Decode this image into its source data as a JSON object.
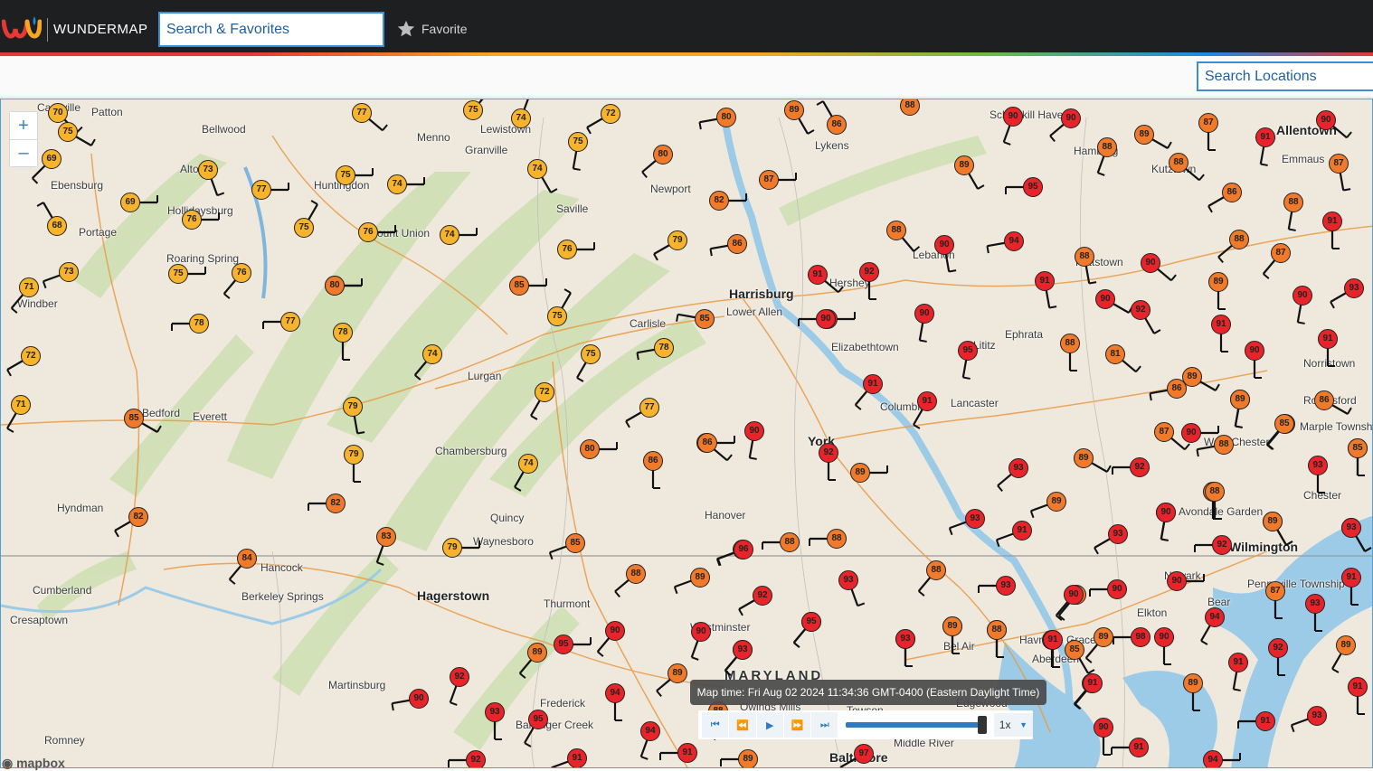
{
  "header": {
    "brand": "WUNDERMAP",
    "search_placeholder": "Search & Favorites",
    "favorite_label": "Favorite"
  },
  "subheader": {
    "location_search_placeholder": "Search Locations"
  },
  "map": {
    "zoom_in_label": "+",
    "zoom_out_label": "–",
    "attribution": "mapbox",
    "state_label": "MARYLAND",
    "places": [
      {
        "name": "Cassville"
      },
      {
        "name": "Patton"
      },
      {
        "name": "Bellwood"
      },
      {
        "name": "Menno"
      },
      {
        "name": "Lewistown"
      },
      {
        "name": "Granville"
      },
      {
        "name": "Altoona"
      },
      {
        "name": "Huntingdon"
      },
      {
        "name": "Ebensburg"
      },
      {
        "name": "Hollidaysburg"
      },
      {
        "name": "Portage"
      },
      {
        "name": "Roaring Spring"
      },
      {
        "name": "Windber"
      },
      {
        "name": "Mount Union"
      },
      {
        "name": "Saville"
      },
      {
        "name": "Newport"
      },
      {
        "name": "Harrisburg"
      },
      {
        "name": "Lower Allen"
      },
      {
        "name": "Carlisle"
      },
      {
        "name": "Hershey"
      },
      {
        "name": "Lebanon"
      },
      {
        "name": "Hamburg"
      },
      {
        "name": "Kutztown"
      },
      {
        "name": "Allentown"
      },
      {
        "name": "Emmaus"
      },
      {
        "name": "Lykens"
      },
      {
        "name": "Schuylkill Haven"
      },
      {
        "name": "Elizabethtown"
      },
      {
        "name": "Lancaster"
      },
      {
        "name": "Columbia"
      },
      {
        "name": "Ephrata"
      },
      {
        "name": "Lititz"
      },
      {
        "name": "Pottstown"
      },
      {
        "name": "Norristown"
      },
      {
        "name": "Royersford"
      },
      {
        "name": "West Chester"
      },
      {
        "name": "Marple Township"
      },
      {
        "name": "Bedford"
      },
      {
        "name": "Everett"
      },
      {
        "name": "Lurgan"
      },
      {
        "name": "Chambersburg"
      },
      {
        "name": "York"
      },
      {
        "name": "Hanover"
      },
      {
        "name": "Quincy"
      },
      {
        "name": "Waynesboro"
      },
      {
        "name": "Hyndman"
      },
      {
        "name": "Hancock"
      },
      {
        "name": "Cumberland"
      },
      {
        "name": "Berkeley Springs"
      },
      {
        "name": "Hagerstown"
      },
      {
        "name": "Thurmont"
      },
      {
        "name": "Westminster"
      },
      {
        "name": "Bel Air"
      },
      {
        "name": "Havre de Grace"
      },
      {
        "name": "Aberdeen"
      },
      {
        "name": "Elkton"
      },
      {
        "name": "Newark"
      },
      {
        "name": "Wilmington"
      },
      {
        "name": "Chester"
      },
      {
        "name": "Avondale Garden"
      },
      {
        "name": "Pennsville Township"
      },
      {
        "name": "Bear"
      },
      {
        "name": "Cresaptown"
      },
      {
        "name": "Martinsburg"
      },
      {
        "name": "Frederick"
      },
      {
        "name": "Ballenger Creek"
      },
      {
        "name": "Owings Mills"
      },
      {
        "name": "Towson"
      },
      {
        "name": "Edgewood"
      },
      {
        "name": "Middle River"
      },
      {
        "name": "Baltimore"
      },
      {
        "name": "Romney"
      }
    ],
    "stations": [
      {
        "t": 70
      },
      {
        "t": 69
      },
      {
        "t": 75
      },
      {
        "t": 73
      },
      {
        "t": 69
      },
      {
        "t": 68
      },
      {
        "t": 73
      },
      {
        "t": 71
      },
      {
        "t": 72
      },
      {
        "t": 71
      },
      {
        "t": 77
      },
      {
        "t": 75
      },
      {
        "t": 74
      },
      {
        "t": 72
      },
      {
        "t": 80
      },
      {
        "t": 89
      },
      {
        "t": 86
      },
      {
        "t": 88
      },
      {
        "t": 90
      },
      {
        "t": 90
      },
      {
        "t": 87
      },
      {
        "t": 89
      },
      {
        "t": 91
      },
      {
        "t": 90
      },
      {
        "t": 75
      },
      {
        "t": 74
      },
      {
        "t": 80
      },
      {
        "t": 87
      },
      {
        "t": 88
      },
      {
        "t": 88
      },
      {
        "t": 89
      },
      {
        "t": 95
      },
      {
        "t": 86
      },
      {
        "t": 87
      },
      {
        "t": 75
      },
      {
        "t": 74
      },
      {
        "t": 75
      },
      {
        "t": 76
      },
      {
        "t": 82
      },
      {
        "t": 88
      },
      {
        "t": 94
      },
      {
        "t": 91
      },
      {
        "t": 88
      },
      {
        "t": 90
      },
      {
        "t": 88
      },
      {
        "t": 87
      },
      {
        "t": 77
      },
      {
        "t": 76
      },
      {
        "t": 74
      },
      {
        "t": 79
      },
      {
        "t": 86
      },
      {
        "t": 91
      },
      {
        "t": 92
      },
      {
        "t": 90
      },
      {
        "t": 76
      },
      {
        "t": 75
      },
      {
        "t": 78
      },
      {
        "t": 78
      },
      {
        "t": 85
      },
      {
        "t": 88
      },
      {
        "t": 90
      },
      {
        "t": 90
      },
      {
        "t": 95
      },
      {
        "t": 91
      },
      {
        "t": 90
      },
      {
        "t": 93
      },
      {
        "t": 80
      },
      {
        "t": 76
      },
      {
        "t": 77
      },
      {
        "t": 78
      },
      {
        "t": 74
      },
      {
        "t": 72
      },
      {
        "t": 75
      },
      {
        "t": 79
      },
      {
        "t": 85
      },
      {
        "t": 92
      },
      {
        "t": 91
      },
      {
        "t": 90
      },
      {
        "t": 96
      },
      {
        "t": 90
      },
      {
        "t": 89
      },
      {
        "t": 91
      },
      {
        "t": 90
      },
      {
        "t": 88
      },
      {
        "t": 81
      },
      {
        "t": 78
      },
      {
        "t": 75
      },
      {
        "t": 77
      },
      {
        "t": 86
      },
      {
        "t": 80
      },
      {
        "t": 81
      },
      {
        "t": 74
      },
      {
        "t": 83
      },
      {
        "t": 82
      },
      {
        "t": 79
      },
      {
        "t": 86
      },
      {
        "t": 90
      },
      {
        "t": 91
      },
      {
        "t": 89
      },
      {
        "t": 92
      },
      {
        "t": 93
      },
      {
        "t": 91
      },
      {
        "t": 93
      },
      {
        "t": 89
      },
      {
        "t": 92
      },
      {
        "t": 89
      },
      {
        "t": 90
      },
      {
        "t": 86
      },
      {
        "t": 82
      },
      {
        "t": 85
      },
      {
        "t": 89
      },
      {
        "t": 84
      },
      {
        "t": 86
      },
      {
        "t": 88
      },
      {
        "t": 83
      },
      {
        "t": 79
      },
      {
        "t": 85
      },
      {
        "t": 96
      },
      {
        "t": 88
      },
      {
        "t": 88
      },
      {
        "t": 87
      },
      {
        "t": 93
      },
      {
        "t": 91
      },
      {
        "t": 93
      },
      {
        "t": 89
      },
      {
        "t": 89
      },
      {
        "t": 91
      },
      {
        "t": 88
      },
      {
        "t": 89
      },
      {
        "t": 93
      },
      {
        "t": 86
      },
      {
        "t": 85
      },
      {
        "t": 85
      },
      {
        "t": 88
      },
      {
        "t": 90
      },
      {
        "t": 93
      },
      {
        "t": 92
      },
      {
        "t": 89
      },
      {
        "t": 90
      },
      {
        "t": 91
      },
      {
        "t": 90
      },
      {
        "t": 89
      },
      {
        "t": 94
      },
      {
        "t": 91
      },
      {
        "t": 92
      },
      {
        "t": 93
      },
      {
        "t": 87
      },
      {
        "t": 85
      },
      {
        "t": 89
      },
      {
        "t": 98
      },
      {
        "t": 89
      },
      {
        "t": 95
      },
      {
        "t": 91
      },
      {
        "t": 90
      },
      {
        "t": 89
      },
      {
        "t": 93
      },
      {
        "t": 89
      },
      {
        "t": 91
      },
      {
        "t": 91
      },
      {
        "t": 95
      },
      {
        "t": 90
      },
      {
        "t": 90
      },
      {
        "t": 91
      },
      {
        "t": 92
      },
      {
        "t": 93
      },
      {
        "t": 88
      },
      {
        "t": 87
      },
      {
        "t": 88
      },
      {
        "t": 91
      },
      {
        "t": 91
      },
      {
        "t": 88
      },
      {
        "t": 93
      },
      {
        "t": 92
      },
      {
        "t": 89
      },
      {
        "t": 88
      },
      {
        "t": 90
      },
      {
        "t": 94
      },
      {
        "t": 91
      },
      {
        "t": 90
      },
      {
        "t": 88
      },
      {
        "t": 89
      },
      {
        "t": 93
      },
      {
        "t": 88
      },
      {
        "t": 97
      },
      {
        "t": 95
      },
      {
        "t": 93
      },
      {
        "t": 89
      },
      {
        "t": 94
      },
      {
        "t": 88
      },
      {
        "t": 91
      },
      {
        "t": 89
      },
      {
        "t": 91
      },
      {
        "t": 92
      },
      {
        "t": 90
      },
      {
        "t": 95
      },
      {
        "t": 93
      },
      {
        "t": 89
      },
      {
        "t": 94
      },
      {
        "t": 92
      }
    ]
  },
  "player": {
    "map_time_label": "Map time:",
    "map_time": "Fri Aug 02 2024 11:34:36 GMT-0400 (Eastern Daylight Time)",
    "speed": "1x",
    "accent_color": "#2e7bbf"
  },
  "colors": {
    "topbar": "#1d1f21",
    "temp_70s": "#f7b32b",
    "temp_80s": "#f07a2a",
    "temp_90s": "#e8242a"
  }
}
